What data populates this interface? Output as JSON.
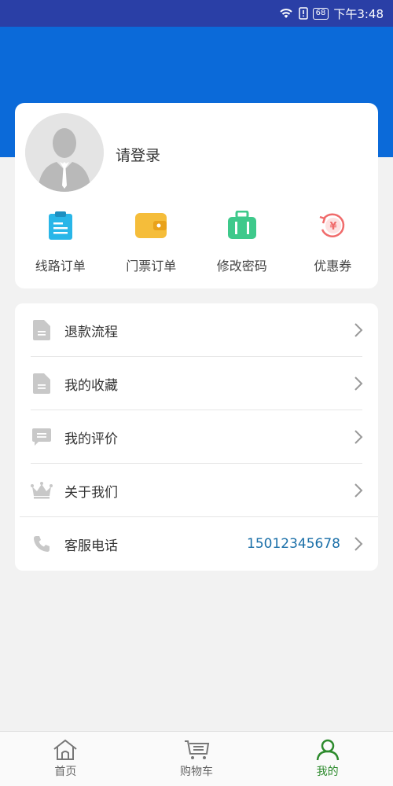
{
  "status_bar": {
    "time": "下午3:48",
    "battery": "68"
  },
  "profile": {
    "login_prompt": "请登录"
  },
  "quick_actions": [
    {
      "label": "线路订单",
      "icon": "clipboard-icon",
      "color": "#29b6e8"
    },
    {
      "label": "门票订单",
      "icon": "wallet-icon",
      "color": "#f5bd3a"
    },
    {
      "label": "修改密码",
      "icon": "suitcase-icon",
      "color": "#3ec98b"
    },
    {
      "label": "优惠券",
      "icon": "coupon-yen-icon",
      "color": "#f06b6b"
    }
  ],
  "menu": [
    {
      "label": "退款流程",
      "icon": "document-icon"
    },
    {
      "label": "我的收藏",
      "icon": "document-icon"
    },
    {
      "label": "我的评价",
      "icon": "comment-icon"
    },
    {
      "label": "关于我们",
      "icon": "crown-icon"
    },
    {
      "label": "客服电话",
      "icon": "phone-icon",
      "value": "15012345678"
    }
  ],
  "tabs": [
    {
      "label": "首页",
      "icon": "home-icon",
      "active": false
    },
    {
      "label": "购物车",
      "icon": "cart-icon",
      "active": false
    },
    {
      "label": "我的",
      "icon": "user-icon",
      "active": true
    }
  ],
  "colors": {
    "header_blue": "#0b6ad9",
    "status_blue": "#2a3fa6",
    "active_tab_green": "#2c8a2c",
    "phone_value": "#1a6fa8"
  }
}
